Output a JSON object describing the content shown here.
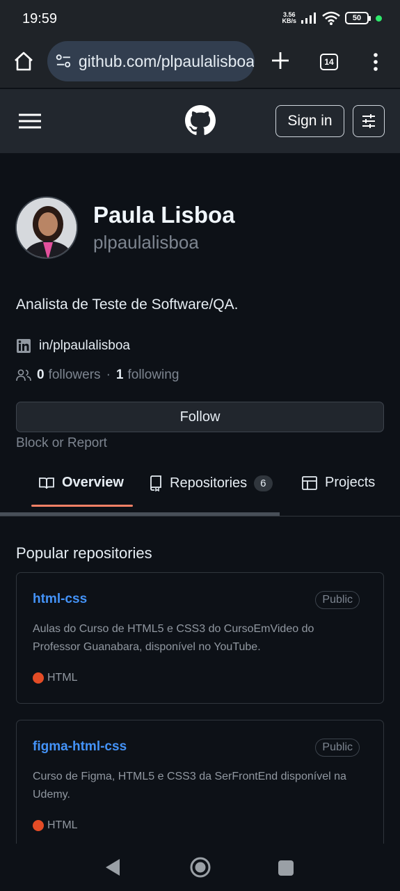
{
  "status_bar": {
    "time": "19:59",
    "net_speed_value": "3.56",
    "net_speed_unit": "KB/s",
    "battery": "50"
  },
  "browser": {
    "url": "github.com/plpaulalisboa",
    "tab_count": "14"
  },
  "header": {
    "sign_in_label": "Sign in"
  },
  "profile": {
    "name": "Paula Lisboa",
    "username": "plpaulalisboa",
    "bio": "Analista de Teste de Software/QA.",
    "linkedin": "in/plpaulalisboa",
    "followers_count": "0",
    "followers_label": "followers",
    "separator": "·",
    "following_count": "1",
    "following_label": "following",
    "follow_label": "Follow",
    "block_report_label": "Block or Report"
  },
  "tabs": [
    {
      "label": "Overview",
      "icon": "book-icon"
    },
    {
      "label": "Repositories",
      "icon": "repo-icon",
      "count": "6"
    },
    {
      "label": "Projects",
      "icon": "table-icon"
    }
  ],
  "popular": {
    "title": "Popular repositories",
    "repos": [
      {
        "name": "html-css",
        "visibility": "Public",
        "description": "Aulas do Curso de HTML5 e CSS3 do CursoEmVideo do Professor Guanabara, disponível no YouTube.",
        "language": "HTML",
        "language_color": "#e34c26"
      },
      {
        "name": "figma-html-css",
        "visibility": "Public",
        "description": "Curso de Figma, HTML5 e CSS3 da SerFrontEnd disponível na Udemy.",
        "language": "HTML",
        "language_color": "#e34c26"
      }
    ]
  },
  "colors": {
    "background": "#0d1117",
    "link": "#4493f8",
    "tab_underline": "#f78166"
  }
}
